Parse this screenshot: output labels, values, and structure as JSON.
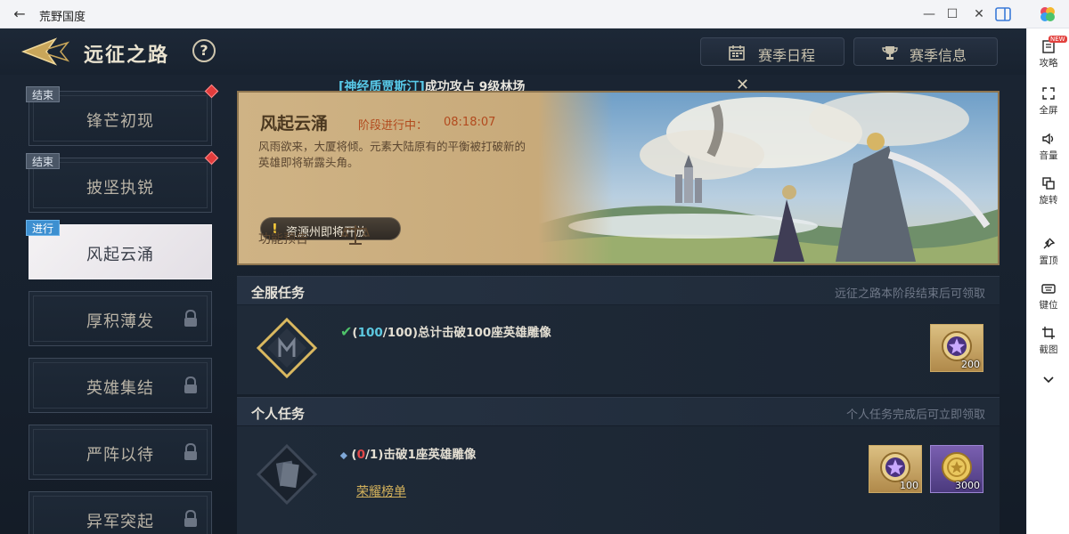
{
  "window": {
    "title": "荒野国度"
  },
  "header": {
    "title": "远征之路",
    "help_label": "?",
    "season_schedule": "赛季日程",
    "season_info": "赛季信息"
  },
  "stages": [
    {
      "name": "锋芒初现",
      "tag": "结束",
      "has_dot": true,
      "locked": false,
      "active": false
    },
    {
      "name": "披坚执锐",
      "tag": "结束",
      "has_dot": true,
      "locked": false,
      "active": false
    },
    {
      "name": "风起云涌",
      "tag": "进行",
      "has_dot": false,
      "locked": false,
      "active": true
    },
    {
      "name": "厚积薄发",
      "tag": "",
      "has_dot": false,
      "locked": true,
      "active": false
    },
    {
      "name": "英雄集结",
      "tag": "",
      "has_dot": false,
      "locked": true,
      "active": false
    },
    {
      "name": "严阵以待",
      "tag": "",
      "has_dot": false,
      "locked": true,
      "active": false
    },
    {
      "name": "异军突起",
      "tag": "",
      "has_dot": false,
      "locked": true,
      "active": false
    }
  ],
  "announcement": {
    "player": "[神经质贾斯汀]",
    "text": "成功攻占 9级林场",
    "close": "✕"
  },
  "banner": {
    "title": "风起云涌",
    "status": "阶段进行中：",
    "time": "08:18:07",
    "desc": "风雨欲来，大厦将倾。元素大陆原有的平衡被打破新的英雄即将崭露头角。",
    "resource_notice": "资源州即将开放",
    "preview_label": "功能预告"
  },
  "server_tasks": {
    "title": "全服任务",
    "hint": "远征之路本阶段结束后可领取",
    "tasks": [
      {
        "current": "100",
        "total": "/100)",
        "desc": "总计击破100座英雄雕像",
        "reward_amount": "200"
      }
    ]
  },
  "personal_tasks": {
    "title": "个人任务",
    "hint": "个人任务完成后可立即领取",
    "tasks": [
      {
        "current": "0",
        "total": "/1)",
        "desc": "击破1座英雄雕像",
        "link": "荣耀榜单",
        "reward_amounts": [
          "100",
          "3000"
        ]
      }
    ]
  },
  "rail": [
    {
      "label": "攻略",
      "icon": "guide-icon",
      "badge": "NEW"
    },
    {
      "label": "全屏",
      "icon": "fullscreen-icon"
    },
    {
      "label": "音量",
      "icon": "volume-icon"
    },
    {
      "label": "旋转",
      "icon": "rotate-icon"
    },
    {
      "label": "置顶",
      "icon": "pin-icon"
    },
    {
      "label": "键位",
      "icon": "keyboard-icon"
    },
    {
      "label": "截图",
      "icon": "crop-icon"
    }
  ],
  "colors": {
    "accent_cyan": "#58c9e8",
    "progress_red": "#e24848",
    "check_green": "#4fc36a",
    "link_gold": "#d4b25c"
  }
}
